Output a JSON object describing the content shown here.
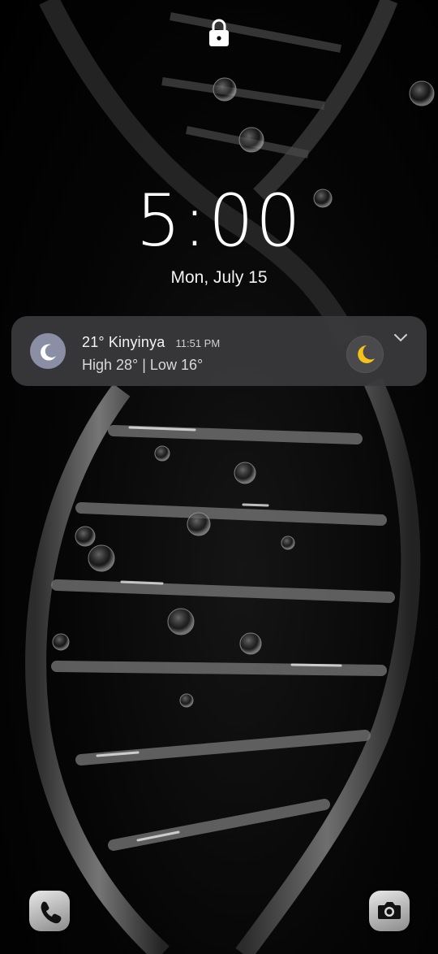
{
  "lockscreen": {
    "clock": "5:00",
    "date": "Mon, July 15"
  },
  "weather": {
    "temperature": "21°",
    "location": "Kinyinya",
    "updated_time": "11:51 PM",
    "high_low": "High 28° | Low 16°",
    "condition_icon": "moon-icon",
    "accent_color": "#f5c21b"
  },
  "shortcuts": {
    "left_icon": "phone-icon",
    "right_icon": "camera-icon"
  },
  "status": {
    "lock_icon": "lock-icon"
  }
}
